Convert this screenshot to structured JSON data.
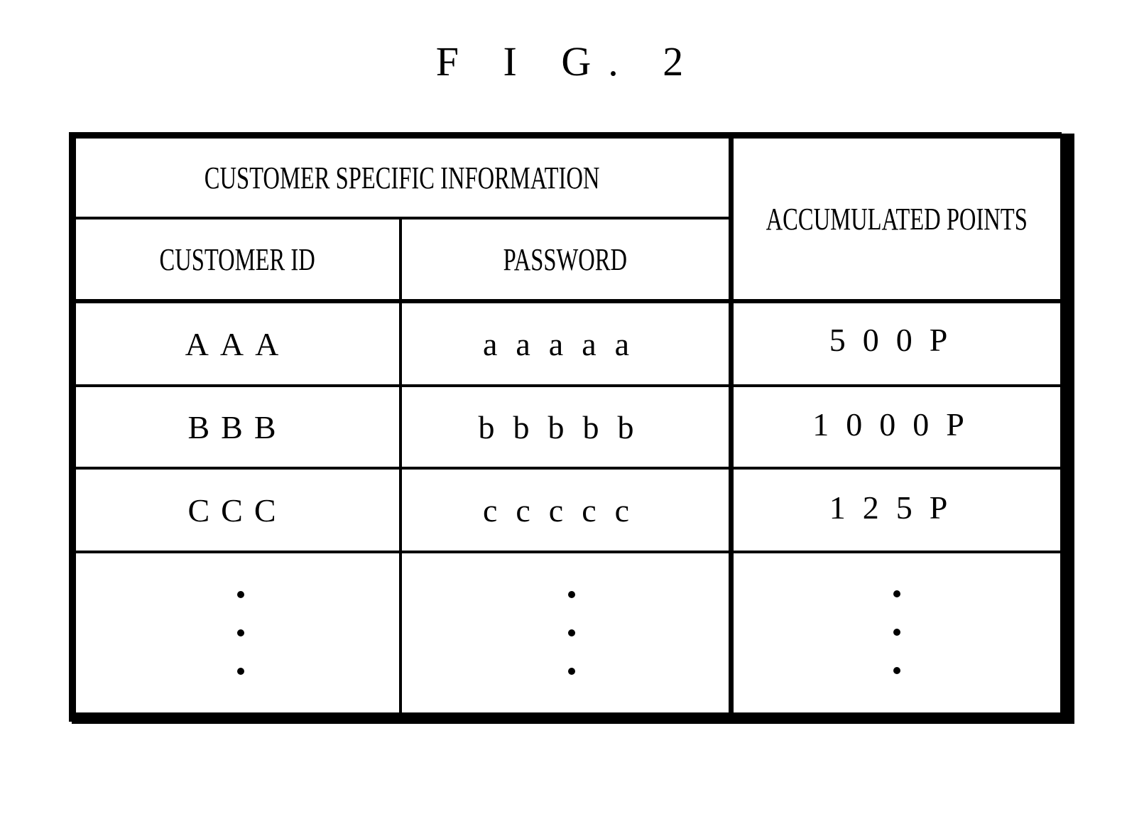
{
  "figure": {
    "title": "F I G. 2"
  },
  "table": {
    "group_header": "CUSTOMER SPECIFIC INFORMATION",
    "columns": [
      {
        "key": "customer_id",
        "label": "CUSTOMER ID"
      },
      {
        "key": "password",
        "label": "PASSWORD"
      },
      {
        "key": "accumulated_points",
        "label": "ACCUMULATED POINTS"
      }
    ],
    "rows": [
      {
        "customer_id": "AAA",
        "password": "aaaaa",
        "accumulated_points": "500P"
      },
      {
        "customer_id": "BBB",
        "password": "bbbbb",
        "accumulated_points": "1000P"
      },
      {
        "customer_id": "CCC",
        "password": "ccccc",
        "accumulated_points": "125P"
      }
    ],
    "continuation": {
      "customer_id": "⋮",
      "password": "⋮",
      "accumulated_points": "⋮"
    }
  }
}
